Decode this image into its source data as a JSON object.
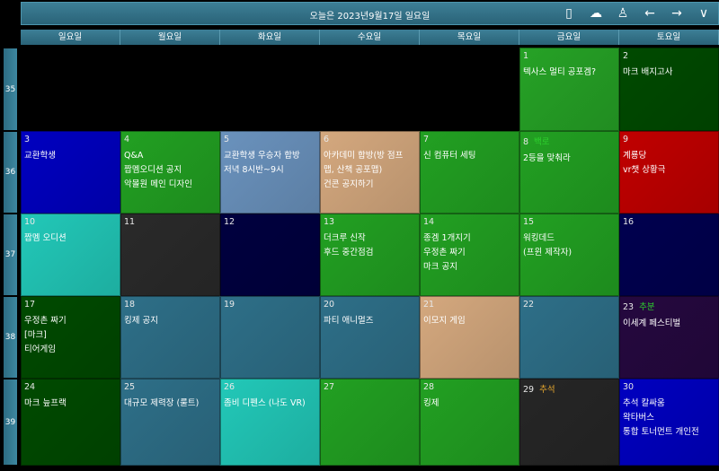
{
  "header": {
    "title": "오늘은 2023년9월17일 일요일"
  },
  "toolbar_icons": [
    {
      "name": "phone-icon",
      "glyph": "▯"
    },
    {
      "name": "cloud-check-icon",
      "glyph": "☁"
    },
    {
      "name": "user-icon",
      "glyph": "♙"
    },
    {
      "name": "arrow-left-icon",
      "glyph": "←"
    },
    {
      "name": "arrow-right-icon",
      "glyph": "→"
    },
    {
      "name": "chevron-down-icon",
      "glyph": "∨"
    }
  ],
  "weekdays": [
    "일요일",
    "월요일",
    "화요일",
    "수요일",
    "목요일",
    "금요일",
    "토요일"
  ],
  "week_numbers": [
    "35",
    "36",
    "37",
    "38",
    "39"
  ],
  "cells": [
    {
      "row": 0,
      "col": 5,
      "day": "1",
      "color": "#26a226",
      "events": [
        "텍사스 멀티 공포겜?"
      ]
    },
    {
      "row": 0,
      "col": 6,
      "day": "2",
      "color": "#004a00",
      "events": [
        "마크 배지고사"
      ]
    },
    {
      "row": 1,
      "col": 0,
      "day": "3",
      "color": "#0000c0",
      "events": [
        "교환학생"
      ]
    },
    {
      "row": 1,
      "col": 1,
      "day": "4",
      "color": "#22a022",
      "events": [
        "Q&A",
        "짭멤오디션 공지",
        "악몰원 메인 디자인"
      ]
    },
    {
      "row": 1,
      "col": 2,
      "day": "5",
      "color": "#6a92bd",
      "events": [
        "교환학생 우승자 합방",
        "저녁 8시반~9시"
      ]
    },
    {
      "row": 1,
      "col": 3,
      "day": "6",
      "color": "#d4a87e",
      "events": [
        "아카데미 합방(방 점프",
        "맵, 산책 공포맵)",
        "건콘 공지하기"
      ]
    },
    {
      "row": 1,
      "col": 4,
      "day": "7",
      "color": "#22a022",
      "events": [
        "신 컴퓨터 세팅"
      ]
    },
    {
      "row": 1,
      "col": 5,
      "day": "8",
      "holiday": "백로",
      "holiday_color": "#2ed12e",
      "color": "#22a022",
      "events": [
        "2등을 맞춰라"
      ]
    },
    {
      "row": 1,
      "col": 6,
      "day": "9",
      "color": "#c00000",
      "events": [
        "계룡당",
        "vr챗 상황극"
      ]
    },
    {
      "row": 2,
      "col": 0,
      "day": "10",
      "color": "#22c8b8",
      "events": [
        "짭멤 오디션"
      ]
    },
    {
      "row": 2,
      "col": 1,
      "day": "11",
      "color": "#2a2a2a",
      "events": []
    },
    {
      "row": 2,
      "col": 2,
      "day": "12",
      "color": "#00003f",
      "events": []
    },
    {
      "row": 2,
      "col": 3,
      "day": "13",
      "color": "#22a022",
      "events": [
        "더크루 신작",
        "후드 중간점검"
      ]
    },
    {
      "row": 2,
      "col": 4,
      "day": "14",
      "color": "#22a022",
      "events": [
        "종겜 1개지기",
        "우정촌 짜기",
        "마크 공지"
      ]
    },
    {
      "row": 2,
      "col": 5,
      "day": "15",
      "color": "#22a022",
      "events": [
        "워킹데드",
        "(프윈 제작자)"
      ]
    },
    {
      "row": 2,
      "col": 6,
      "day": "16",
      "color": "#00004f",
      "events": []
    },
    {
      "row": 3,
      "col": 0,
      "day": "17",
      "color": "#004a00",
      "events": [
        "우정촌 짜기",
        "[마크]",
        "티어게임"
      ]
    },
    {
      "row": 3,
      "col": 1,
      "day": "18",
      "color": "#2e6f88",
      "events": [
        "킹제 공지"
      ]
    },
    {
      "row": 3,
      "col": 2,
      "day": "19",
      "color": "#2e6f88",
      "events": []
    },
    {
      "row": 3,
      "col": 3,
      "day": "20",
      "color": "#2e6f88",
      "events": [
        "파티 애니멀즈"
      ]
    },
    {
      "row": 3,
      "col": 4,
      "day": "21",
      "color": "#d4a87e",
      "events": [
        "이모지 게임"
      ]
    },
    {
      "row": 3,
      "col": 5,
      "day": "22",
      "color": "#2e6f88",
      "events": []
    },
    {
      "row": 3,
      "col": 6,
      "day": "23",
      "holiday": "추분",
      "holiday_color": "#2ed12e",
      "color": "#25083f",
      "events": [
        "이세계 페스티벌"
      ]
    },
    {
      "row": 4,
      "col": 0,
      "day": "24",
      "color": "#004a00",
      "events": [
        "마크 늪프랙"
      ]
    },
    {
      "row": 4,
      "col": 1,
      "day": "25",
      "color": "#2e6f88",
      "events": [
        "대규모 제력장 (룰트)"
      ]
    },
    {
      "row": 4,
      "col": 2,
      "day": "26",
      "color": "#22c8b8",
      "events": [
        "좀비 디펜스 (나도 VR)"
      ]
    },
    {
      "row": 4,
      "col": 3,
      "day": "27",
      "color": "#22a022",
      "events": []
    },
    {
      "row": 4,
      "col": 4,
      "day": "28",
      "color": "#22a022",
      "events": [
        "킹제"
      ]
    },
    {
      "row": 4,
      "col": 5,
      "day": "29",
      "holiday": "추석",
      "holiday_color": "#e6a72e",
      "color": "#262626",
      "events": []
    },
    {
      "row": 4,
      "col": 6,
      "day": "30",
      "color": "#0000c0",
      "events": [
        "추석 칼싸움",
        "왁타버스",
        "통합 토너먼트 개인전"
      ]
    }
  ]
}
